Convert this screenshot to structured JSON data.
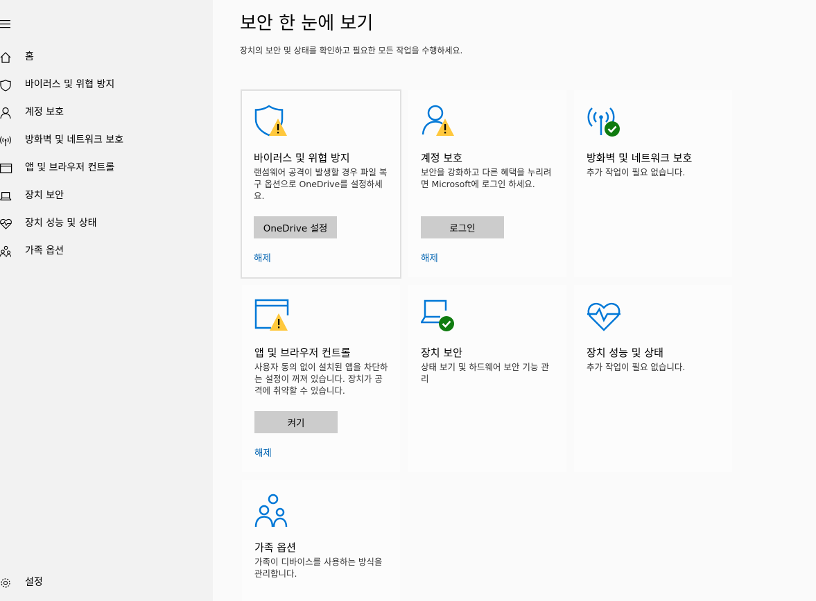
{
  "sidebar": {
    "items": [
      {
        "label": "홈",
        "icon": "home-icon"
      },
      {
        "label": "바이러스 및 위협 방지",
        "icon": "shield-icon"
      },
      {
        "label": "계정 보호",
        "icon": "person-icon"
      },
      {
        "label": "방화벽 및 네트워크 보호",
        "icon": "network-icon"
      },
      {
        "label": "앱 및 브라우저 컨트롤",
        "icon": "browser-icon"
      },
      {
        "label": "장치 보안",
        "icon": "laptop-icon"
      },
      {
        "label": "장치 성능 및 상태",
        "icon": "heart-icon"
      },
      {
        "label": "가족 옵션",
        "icon": "family-icon"
      }
    ],
    "settings_label": "설정"
  },
  "main": {
    "title": "보안 한 눈에 보기",
    "subtitle": "장치의 보안 및 상태를 확인하고 필요한 모든 작업을 수행하세요."
  },
  "cards": {
    "virus": {
      "title": "바이러스 및 위협 방지",
      "desc": "랜섬웨어 공격이 발생할 경우 파일 복구 옵션으로 OneDrive를 설정하세요.",
      "button": "OneDrive 설정",
      "link": "해제",
      "status": "warning"
    },
    "account": {
      "title": "계정 보호",
      "desc": "보안을 강화하고 다른 혜택을 누리려면 Microsoft에 로그인 하세요.",
      "button": "로그인",
      "link": "해제",
      "status": "warning"
    },
    "firewall": {
      "title": "방화벽 및 네트워크 보호",
      "desc": "추가 작업이 필요 없습니다.",
      "status": "ok"
    },
    "app": {
      "title": "앱 및 브라우저 컨트롤",
      "desc": "사용자 동의 없이 설치된 앱을 차단하는 설정이 꺼져 있습니다. 장치가 공격에 취약할 수 있습니다.",
      "button": "켜기",
      "link": "해제",
      "status": "warning"
    },
    "device": {
      "title": "장치 보안",
      "desc": "상태 보기 및 하드웨어 보안 기능 관리",
      "status": "ok"
    },
    "performance": {
      "title": "장치 성능 및 상태",
      "desc": "추가 작업이 필요 없습니다."
    },
    "family": {
      "title": "가족 옵션",
      "desc": "가족이 디바이스를 사용하는 방식을 관리합니다."
    }
  },
  "colors": {
    "accent": "#0063b1",
    "icon_blue": "#0078d7",
    "warning": "#ffc83d",
    "ok": "#107c10",
    "sidebar_bg": "#f2f2f2",
    "button_bg": "#cccccc"
  }
}
